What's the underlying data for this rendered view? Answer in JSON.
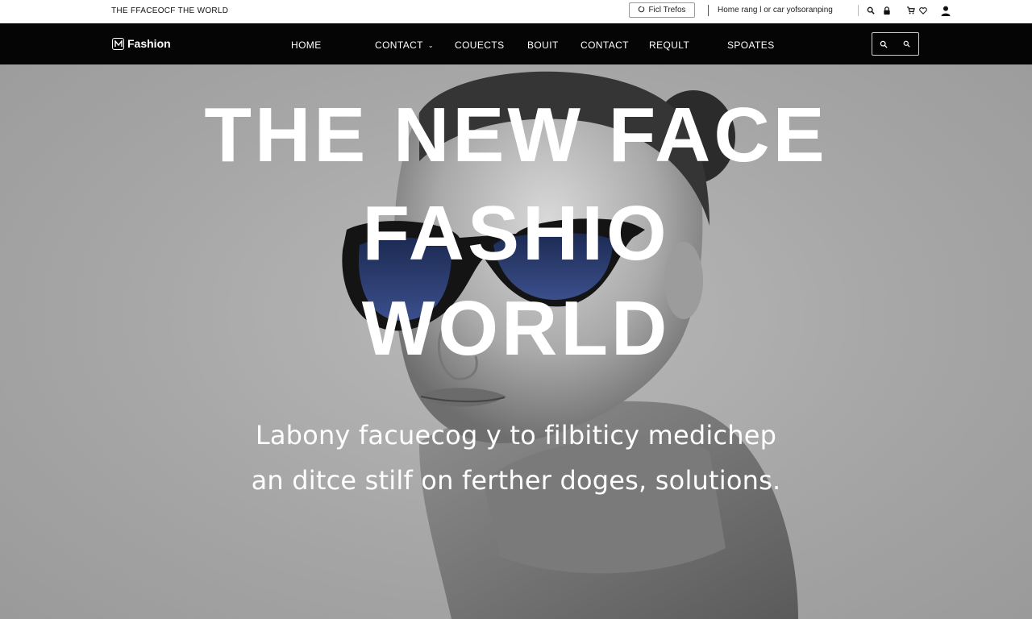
{
  "topbar": {
    "tagline": "THE FFACEOCF THE WORLD",
    "find_button_label": "Ficl Trefos",
    "utility_text": "Home rang l or car yofsoranping",
    "icons": [
      "search-icon",
      "lock-icon",
      "cart-icon",
      "heart-icon",
      "user-icon"
    ]
  },
  "nav": {
    "logo_text": "Fashion",
    "items": [
      {
        "label": "HOME"
      },
      {
        "label": "CONTACT",
        "has_dropdown": true
      },
      {
        "label": "COUECTS"
      },
      {
        "label": "BOUIT"
      },
      {
        "label": "CONTACT"
      },
      {
        "label": "REQULT"
      },
      {
        "label": "SPOATES"
      }
    ],
    "search_icons": [
      "search-icon",
      "search-icon"
    ]
  },
  "hero": {
    "headline_lines": [
      "THE NEW FACE",
      "FASHIO",
      "WORLD"
    ],
    "subtext_lines": [
      "Labony facuecog y to filbiticy medichep",
      "an ditce stilf on ferther doges, solutions."
    ],
    "lens_color": "#3b4f8c"
  }
}
